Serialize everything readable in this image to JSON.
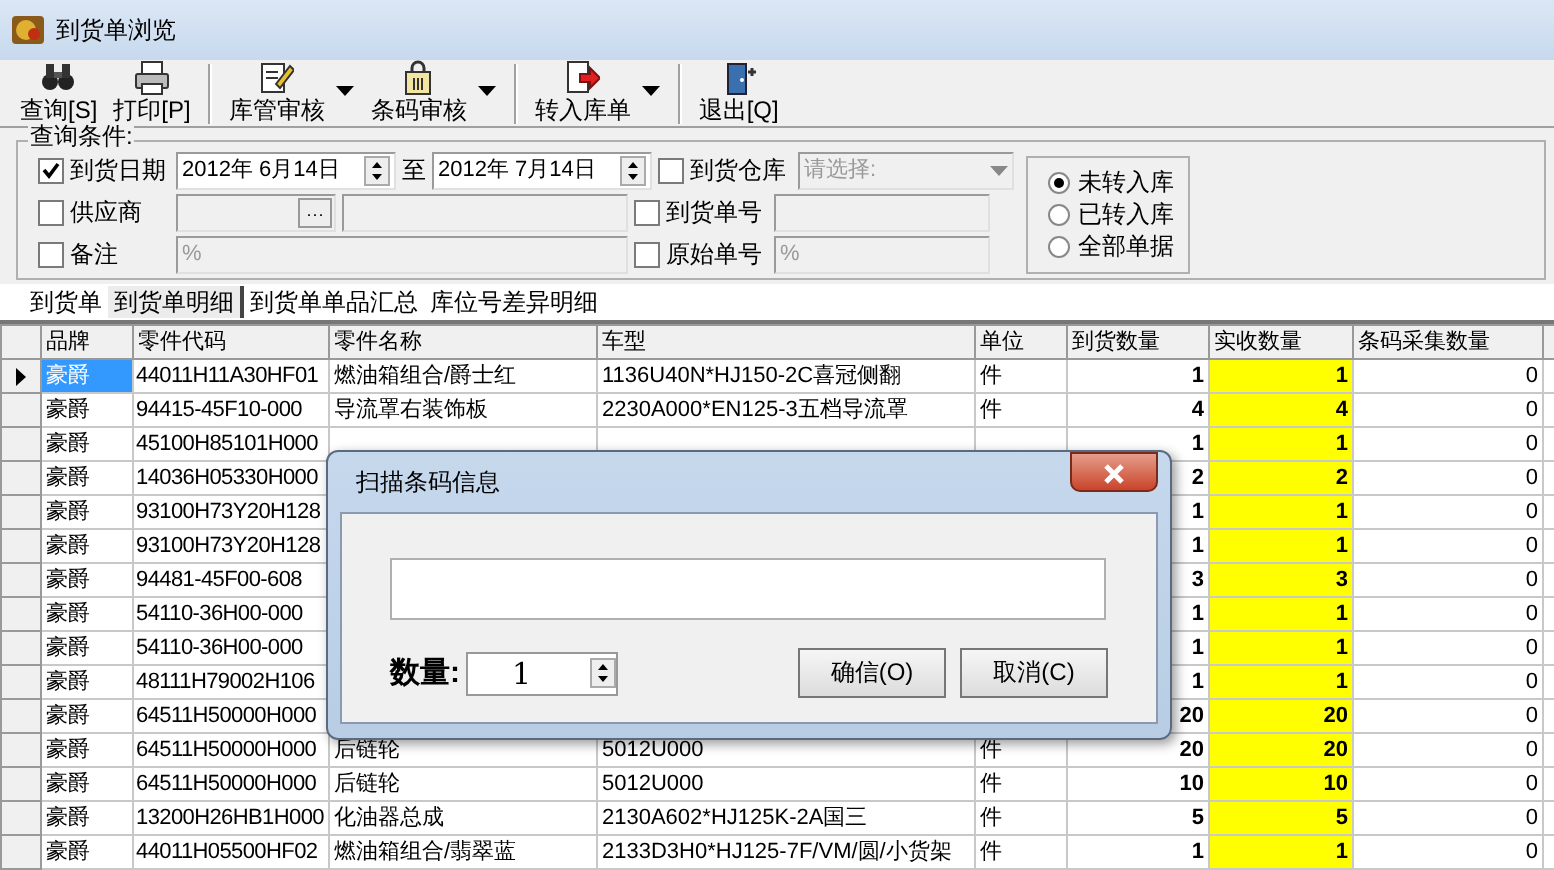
{
  "window": {
    "title": "到货单浏览"
  },
  "toolbar": [
    {
      "label": "查询[S]",
      "dropdown": false,
      "separator_before": false
    },
    {
      "label": "打印[P]",
      "dropdown": false,
      "separator_before": false
    },
    {
      "label": "库管审核",
      "dropdown": true,
      "separator_before": true
    },
    {
      "label": "条码审核",
      "dropdown": true,
      "separator_before": false
    },
    {
      "label": "转入库单",
      "dropdown": true,
      "separator_before": true
    },
    {
      "label": "退出[Q]",
      "dropdown": false,
      "separator_before": true
    }
  ],
  "query": {
    "title": "查询条件:",
    "arrival_date": {
      "label": "到货日期",
      "checked": true,
      "from": "2012年 6月14日",
      "between": "至",
      "to": "2012年 7月14日"
    },
    "warehouse": {
      "label": "到货仓库",
      "checked": false,
      "placeholder": "请选择:"
    },
    "supplier": {
      "label": "供应商",
      "checked": false,
      "browse": "···"
    },
    "arrival_no": {
      "label": "到货单号",
      "checked": false
    },
    "remark": {
      "label": "备注",
      "checked": false,
      "value": "%"
    },
    "original_no": {
      "label": "原始单号",
      "checked": false,
      "value": "%"
    },
    "status_options": [
      {
        "label": "未转入库",
        "selected": true
      },
      {
        "label": "已转入库",
        "selected": false
      },
      {
        "label": "全部单据",
        "selected": false
      }
    ]
  },
  "tabs": [
    {
      "label": "到货单",
      "selected": false
    },
    {
      "label": "到货单明细",
      "selected": true
    },
    {
      "label": "到货单单品汇总",
      "selected": false
    },
    {
      "label": "库位号差异明细",
      "selected": false
    }
  ],
  "grid": {
    "columns": [
      {
        "label": "品牌",
        "kind": "text",
        "highlight": false
      },
      {
        "label": "零件代码",
        "kind": "text",
        "highlight": false
      },
      {
        "label": "零件名称",
        "kind": "text",
        "highlight": false
      },
      {
        "label": "车型",
        "kind": "text",
        "highlight": false
      },
      {
        "label": "单位",
        "kind": "text",
        "highlight": false
      },
      {
        "label": "到货数量",
        "kind": "bold_number",
        "highlight": false
      },
      {
        "label": "实收数量",
        "kind": "bold_number",
        "highlight": true
      },
      {
        "label": "条码采集数量",
        "kind": "number",
        "highlight": false
      }
    ],
    "rows": [
      {
        "current": true,
        "cells": [
          "豪爵",
          "44011H11A30HF01",
          "燃油箱组合/爵士红",
          "1136U40N*HJ150-2C喜冠侧翻",
          "件",
          "1",
          "1",
          "0"
        ]
      },
      {
        "current": false,
        "cells": [
          "豪爵",
          "94415-45F10-000",
          "导流罩右装饰板",
          "2230A000*EN125-3五档导流罩",
          "件",
          "4",
          "4",
          "0"
        ]
      },
      {
        "current": false,
        "cells": [
          "豪爵",
          "45100H85101H000",
          null,
          null,
          null,
          "1",
          "1",
          "0"
        ]
      },
      {
        "current": false,
        "cells": [
          "豪爵",
          "14036H05330H000",
          null,
          null,
          null,
          "2",
          "2",
          "0"
        ]
      },
      {
        "current": false,
        "cells": [
          "豪爵",
          "93100H73Y20H128",
          null,
          null,
          null,
          "1",
          "1",
          "0"
        ]
      },
      {
        "current": false,
        "cells": [
          "豪爵",
          "93100H73Y20H128",
          null,
          null,
          null,
          "1",
          "1",
          "0"
        ]
      },
      {
        "current": false,
        "cells": [
          "豪爵",
          "94481-45F00-608",
          null,
          null,
          null,
          "3",
          "3",
          "0"
        ]
      },
      {
        "current": false,
        "cells": [
          "豪爵",
          "54110-36H00-000",
          null,
          null,
          null,
          "1",
          "1",
          "0"
        ]
      },
      {
        "current": false,
        "cells": [
          "豪爵",
          "54110-36H00-000",
          null,
          null,
          null,
          "1",
          "1",
          "0"
        ]
      },
      {
        "current": false,
        "cells": [
          "豪爵",
          "48111H79002H106",
          null,
          null,
          null,
          "1",
          "1",
          "0"
        ]
      },
      {
        "current": false,
        "cells": [
          "豪爵",
          "64511H50000H000",
          null,
          null,
          null,
          "20",
          "20",
          "0"
        ]
      },
      {
        "current": false,
        "cells": [
          "豪爵",
          "64511H50000H000",
          "后链轮",
          "5012U000",
          "件",
          "20",
          "20",
          "0"
        ]
      },
      {
        "current": false,
        "cells": [
          "豪爵",
          "64511H50000H000",
          "后链轮",
          "5012U000",
          "件",
          "10",
          "10",
          "0"
        ]
      },
      {
        "current": false,
        "cells": [
          "豪爵",
          "13200H26HB1H000",
          "化油器总成",
          "2130A602*HJ125K-2A国三",
          "件",
          "5",
          "5",
          "0"
        ]
      },
      {
        "current": false,
        "cells": [
          "豪爵",
          "44011H05500HF02",
          "燃油箱组合/翡翠蓝",
          "2133D3H0*HJ125-7F/VM/圆/小货架",
          "件",
          "1",
          "1",
          "0"
        ]
      }
    ]
  },
  "dialog": {
    "title": "扫描条码信息",
    "quantity_label": "数量:",
    "quantity": "1",
    "buttons": [
      "确信(O)",
      "取消(C)"
    ]
  }
}
